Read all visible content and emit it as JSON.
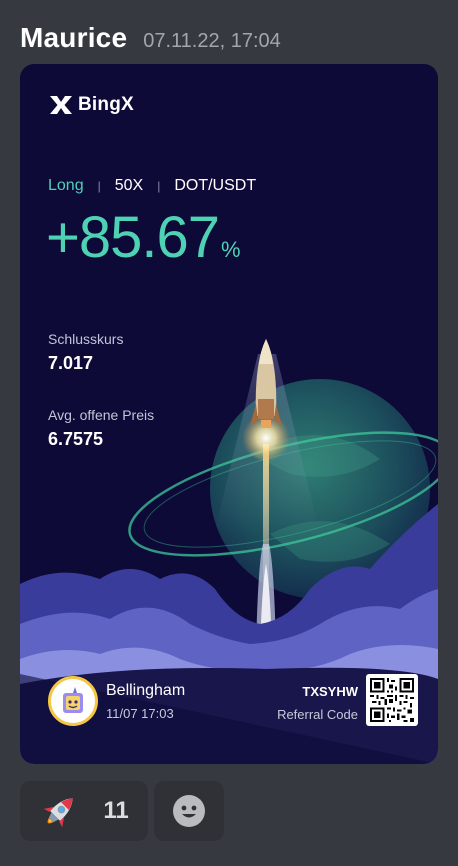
{
  "message": {
    "author": "Maurice",
    "timestamp": "07.11.22, 17:04"
  },
  "card": {
    "brand": "BingX",
    "trade": {
      "side": "Long",
      "leverage": "50X",
      "pair": "DOT/USDT",
      "pnl": "+85.67",
      "pnl_unit": "%"
    },
    "stats": [
      {
        "label": "Schlusskurs",
        "value": "7.017"
      },
      {
        "label": "Avg. offene Preis",
        "value": "6.7575"
      }
    ],
    "user": {
      "name": "Bellingham",
      "datetime": "11/07 17:03"
    },
    "referral": {
      "code": "TXSYHW",
      "label": "Referral Code"
    }
  },
  "reactions": [
    {
      "emoji": "rocket-icon",
      "count": "11"
    }
  ],
  "colors": {
    "background": "#36393f",
    "card": "#0d0a38",
    "accent": "#4fd1b4",
    "reaction_bg": "#2f3136"
  }
}
